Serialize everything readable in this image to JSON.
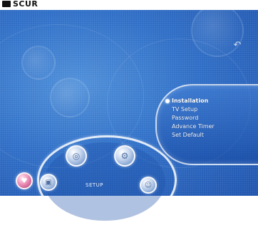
{
  "header": {
    "title": "SCUR",
    "logo_icon": "black-square-icon"
  },
  "screen": {
    "background_color": "#2f6fc7",
    "corner_icon": "curved-arrow-icon"
  },
  "menu": {
    "items": [
      {
        "label": "Installation",
        "selected": true
      },
      {
        "label": "TV Setup",
        "selected": false
      },
      {
        "label": "Password",
        "selected": false
      },
      {
        "label": "Advance Timer",
        "selected": false
      },
      {
        "label": "Set Default",
        "selected": false
      }
    ]
  },
  "carousel": {
    "active_label": "SETUP",
    "icons": [
      "pink-orb-icon",
      "tv-icon",
      "globe-icon",
      "setup-gear-icon",
      "person-icon"
    ]
  }
}
